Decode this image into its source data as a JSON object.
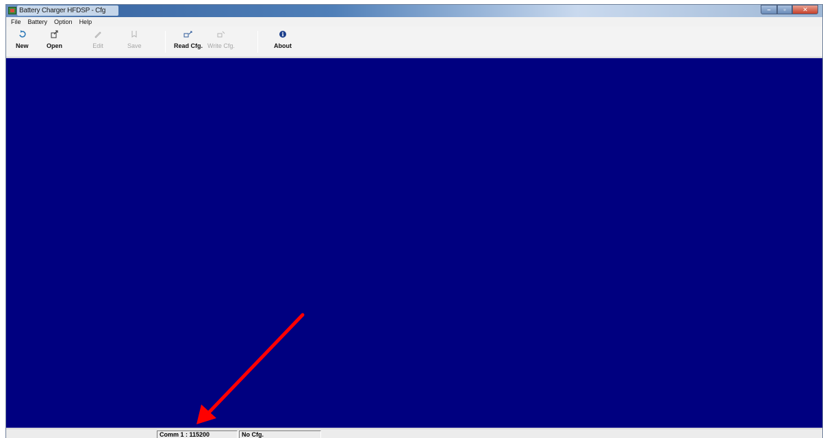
{
  "window": {
    "title": "Battery Charger HFDSP - Cfg",
    "controls": {
      "minimize": "–",
      "maximize": "▫",
      "close": "✕"
    }
  },
  "menu": {
    "items": [
      "File",
      "Battery",
      "Option",
      "Help"
    ]
  },
  "toolbar": {
    "new_label": "New",
    "open_label": "Open",
    "edit_label": "Edit",
    "save_label": "Save",
    "read_cfg_label": "Read Cfg.",
    "write_cfg_label": "Write Cfg.",
    "about_label": "About"
  },
  "statusbar": {
    "port": "Comm 1 : 115200",
    "config": "No Cfg."
  },
  "colors": {
    "client_background": "#000080",
    "annotation_arrow": "#ff0000"
  }
}
